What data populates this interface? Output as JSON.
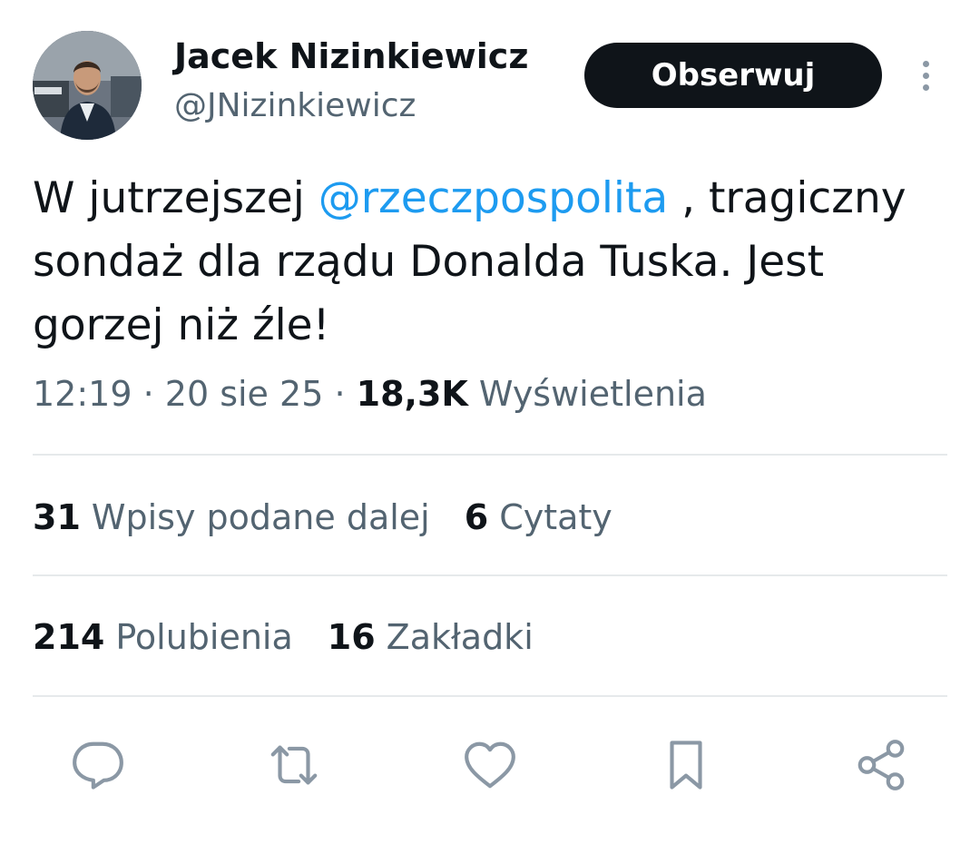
{
  "author": {
    "name": "Jacek Nizinkiewicz",
    "handle": "@JNizinkiewicz"
  },
  "follow_label": "Obserwuj",
  "tweet": {
    "line1_start": "W jutrzejszej ",
    "mention": "@rzeczpospolita",
    "line1_end": " , tragiczny",
    "line2": "sondaż dla rządu Donalda Tuska. Jest",
    "line3": "gorzej niż źle!"
  },
  "meta": {
    "time": "12:19",
    "separator1": " · ",
    "date": "20 sie 25",
    "separator2": " · ",
    "views_count": "18,3K",
    "views_label": " Wyświetlenia"
  },
  "stats": {
    "reposts": {
      "count": "31",
      "label": "Wpisy podane dalej"
    },
    "quotes": {
      "count": "6",
      "label": "Cytaty"
    },
    "likes": {
      "count": "214",
      "label": "Polubienia"
    },
    "bookmarks": {
      "count": "16",
      "label": "Zakładki"
    }
  },
  "actions": [
    "reply-icon",
    "repost-icon",
    "like-icon",
    "bookmark-icon",
    "share-icon"
  ],
  "colors": {
    "text": "#0f1419",
    "secondary": "#536471",
    "link": "#1d9bf0",
    "button": "#0f1419",
    "icon": "#8b98a5",
    "divider": "#e6e9eb"
  }
}
